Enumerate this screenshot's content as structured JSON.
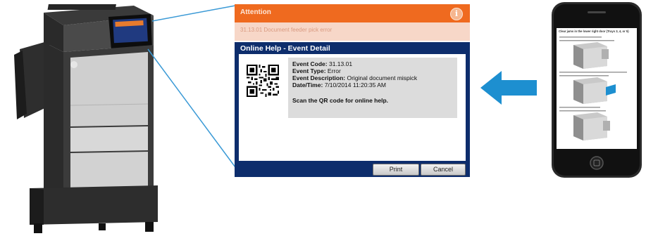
{
  "attention": {
    "title": "Attention",
    "info_glyph": "i",
    "message": "31.13.01 Document feeder pick error"
  },
  "help_dialog": {
    "title": "Online Help - Event Detail",
    "event_code_label": "Event Code:",
    "event_code": "31.13.01",
    "event_type_label": "Event Type:",
    "event_type": "Error",
    "event_description_label": "Event Description:",
    "event_description": "Original document mispick",
    "datetime_label": "Date/Time:",
    "datetime": "7/10/2014 11:20:35 AM",
    "scan_instruction": "Scan the QR code for online help.",
    "print_label": "Print",
    "cancel_label": "Cancel"
  },
  "phone": {
    "page_heading": "Clear jams in the lower right door (Trays 3, 4, or 5)"
  },
  "colors": {
    "attention_bar": "#ef6a1f",
    "attention_bg": "#f7d7c8",
    "dialog_frame": "#0d2d6c",
    "detail_bg": "#dcdcdc",
    "arrow": "#1d8fd0",
    "callout_line": "#3b9ad6"
  },
  "icons": [
    "info-icon",
    "qr-code-icon",
    "left-arrow-icon",
    "printer-illustration",
    "smartphone-illustration"
  ]
}
